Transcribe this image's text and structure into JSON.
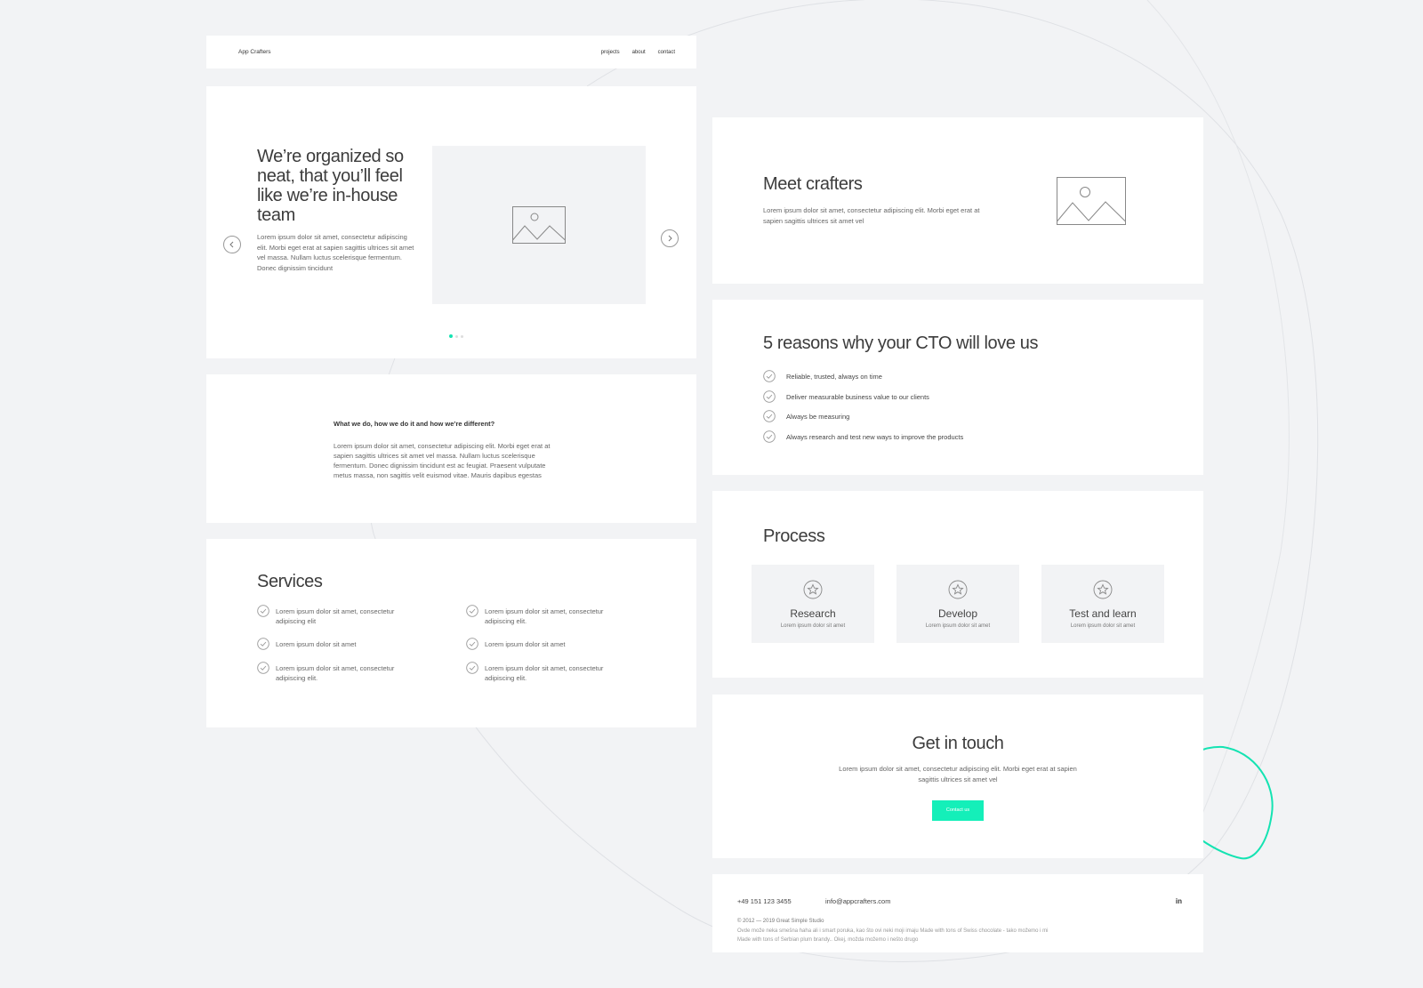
{
  "nav": {
    "logo": "App Crafters",
    "links": [
      "projects",
      "about",
      "contact"
    ]
  },
  "hero": {
    "title": "We’re organized so neat, that you’ll feel like we’re in-house team",
    "description": "Lorem ipsum dolor sit amet, consectetur adipiscing elit. Morbi eget erat at sapien sagittis ultrices sit amet vel massa. Nullam luctus scelerisque fermentum. Donec dignissim tincidunt",
    "prev_icon": "chevron-left-icon",
    "next_icon": "chevron-right-icon",
    "slide_count": 3,
    "active_slide": 1
  },
  "what": {
    "heading": "What we do, how we do it and how we’re different?",
    "body": "Lorem ipsum dolor sit amet, consectetur adipiscing elit. Morbi eget erat at sapien sagittis ultrices sit amet vel massa. Nullam luctus scelerisque fermentum. Donec dignissim tincidunt est ac feugiat. Praesent vulputate metus massa, non sagittis velit euismod vitae. Mauris dapibus egestas"
  },
  "services": {
    "title": "Services",
    "items": [
      "Lorem ipsum dolor sit amet, consectetur adipiscing elit",
      "Lorem ipsum dolor sit amet, consectetur adipiscing elit.",
      "Lorem ipsum dolor sit amet",
      "Lorem ipsum dolor sit amet",
      "Lorem ipsum dolor sit amet, consectetur adipiscing elit.",
      "Lorem ipsum dolor sit amet, consectetur adipiscing elit."
    ]
  },
  "meet": {
    "title": "Meet crafters",
    "description": "Lorem ipsum dolor sit amet, consectetur adipiscing elit. Morbi eget erat at sapien sagittis ultrices sit amet vel"
  },
  "reasons": {
    "title": "5 reasons why your CTO will love us",
    "items": [
      "Reliable, trusted, always on time",
      "Deliver measurable business value to our clients",
      "Always be measuring",
      "Always research and test new ways to improve the products"
    ]
  },
  "process": {
    "title": "Process",
    "steps": [
      {
        "name": "Research",
        "desc": "Lorem ipsum dolor sit amet"
      },
      {
        "name": "Develop",
        "desc": "Lorem ipsum dolor sit amet"
      },
      {
        "name": "Test and learn",
        "desc": "Lorem ipsum dolor sit amet"
      }
    ]
  },
  "contact": {
    "title": "Get in touch",
    "description": "Lorem ipsum dolor sit amet, consectetur adipiscing elit. Morbi eget erat at sapien sagittis ultrices sit amet vel",
    "button": "Contact us"
  },
  "footer": {
    "phone": "+49 151 123 3455",
    "email": "info@appcrafters.com",
    "copyright": "© 2012 — 2019 Great Simple Studio",
    "note": "Ovde može neka smešna haha ali i smart poruka, kao što ovi neki moji imaju Made with tons of Swiss chocolate - tako možemo i mi Made with tons of Serbian plum brandy.. Okej, možda možemo i nešto drugo",
    "social": "in"
  },
  "colors": {
    "accent": "#14efb9",
    "background": "#f2f3f5",
    "card": "#ffffff"
  }
}
